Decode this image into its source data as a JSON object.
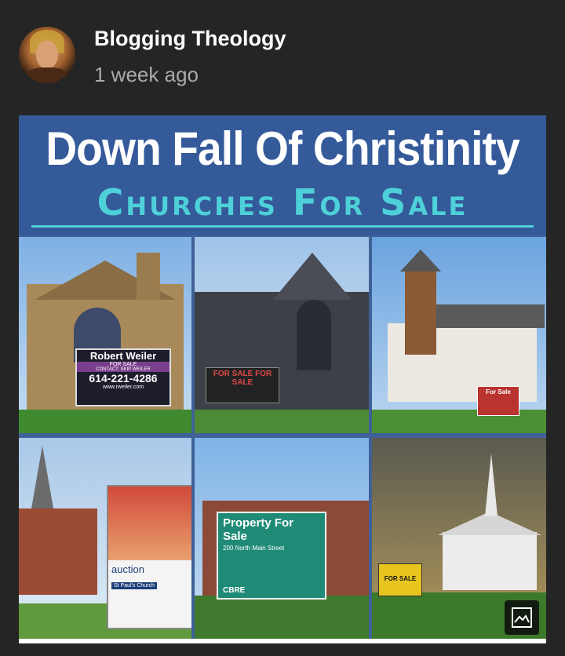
{
  "post": {
    "channel_name": "Blogging Theology",
    "timestamp": "1 week ago"
  },
  "poster": {
    "title": "Down Fall  Of Christinity",
    "subtitle": "Churches For Sale"
  },
  "signs": {
    "robert_weiler_name": "Robert Weiler",
    "robert_weiler_for_sale": "FOR SALE",
    "robert_weiler_contact": "CONTACT: SKIP WEILER",
    "robert_weiler_phone": "614-221-4286",
    "robert_weiler_web": "www.rweiler.com",
    "stone_church_sign": "FOR SALE FOR SALE",
    "white_church_sign": "For Sale",
    "auction_label": "auction",
    "auction_church": "St Paul's Church",
    "property_title": "Property For Sale",
    "property_address": "200 North Main Street",
    "property_brand": "CBRE",
    "chapel_sign": "FOR SALE"
  },
  "icons": {
    "image_icon": "image-icon"
  },
  "colors": {
    "background": "#252525",
    "banner": "#345a9a",
    "subtitle": "#4ed0d8"
  }
}
